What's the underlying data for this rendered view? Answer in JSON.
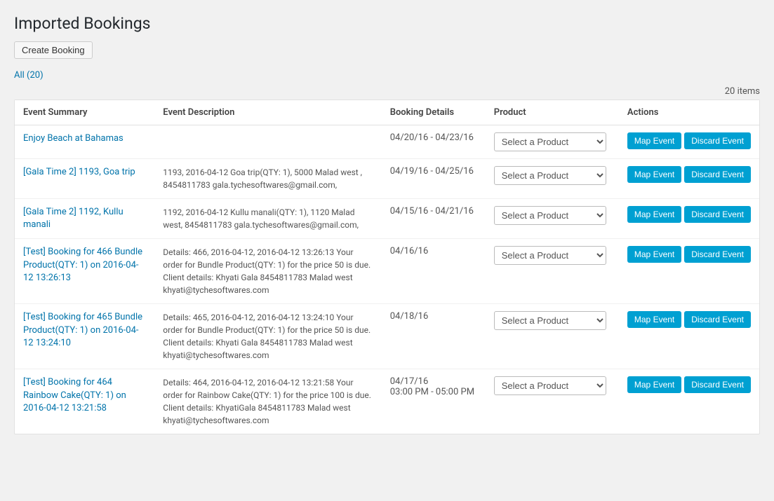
{
  "page": {
    "title": "Imported Bookings",
    "create_booking_label": "Create Booking",
    "all_link_label": "All",
    "all_count": "(20)",
    "items_count": "20 items"
  },
  "table": {
    "headers": {
      "event_summary": "Event Summary",
      "event_description": "Event Description",
      "booking_details": "Booking Details",
      "product": "Product",
      "actions": "Actions"
    },
    "map_event_label": "Map Event",
    "discard_event_label": "Discard Event",
    "select_product_placeholder": "Select a Product",
    "rows": [
      {
        "id": 1,
        "event_summary": "Enjoy Beach at Bahamas",
        "event_description": "",
        "booking_details": "04/20/16 - 04/23/16"
      },
      {
        "id": 2,
        "event_summary": "[Gala Time 2] 1193, Goa trip",
        "event_description": "1193, 2016-04-12 Goa trip(QTY: 1), 5000 Malad west , 8454811783 gala.tychesoftwares@gmail.com,",
        "booking_details": "04/19/16 - 04/25/16"
      },
      {
        "id": 3,
        "event_summary": "[Gala Time 2] 1192, Kullu manali",
        "event_description": "1192, 2016-04-12 Kullu manali(QTY: 1), 1120 Malad west, 8454811783 gala.tychesoftwares@gmail.com,",
        "booking_details": "04/15/16 - 04/21/16"
      },
      {
        "id": 4,
        "event_summary": "[Test] Booking for 466 Bundle Product(QTY: 1) on 2016-04-12 13:26:13",
        "event_description": "Details: 466, 2016-04-12, 2016-04-12 13:26:13 Your order for Bundle Product(QTY: 1) for the price 50 is due. Client details: Khyati Gala 8454811783 Malad west khyati@tychesoftwares.com",
        "booking_details": "04/16/16"
      },
      {
        "id": 5,
        "event_summary": "[Test] Booking for 465 Bundle Product(QTY: 1) on 2016-04-12 13:24:10",
        "event_description": "Details: 465, 2016-04-12, 2016-04-12 13:24:10 Your order for Bundle Product(QTY: 1) for the price 50 is due. Client details: Khyati Gala 8454811783 Malad west khyati@tychesoftwares.com",
        "booking_details": "04/18/16"
      },
      {
        "id": 6,
        "event_summary": "[Test] Booking for 464 Rainbow Cake(QTY: 1) on 2016-04-12 13:21:58",
        "event_description": "Details: 464, 2016-04-12, 2016-04-12 13:21:58 Your order for Rainbow Cake(QTY: 1) for the price 100 is due. Client details: KhyatiGala 8454811783 Malad west khyati@tychesoftwares.com",
        "booking_details": "04/17/16\n03:00 PM - 05:00 PM"
      }
    ]
  }
}
